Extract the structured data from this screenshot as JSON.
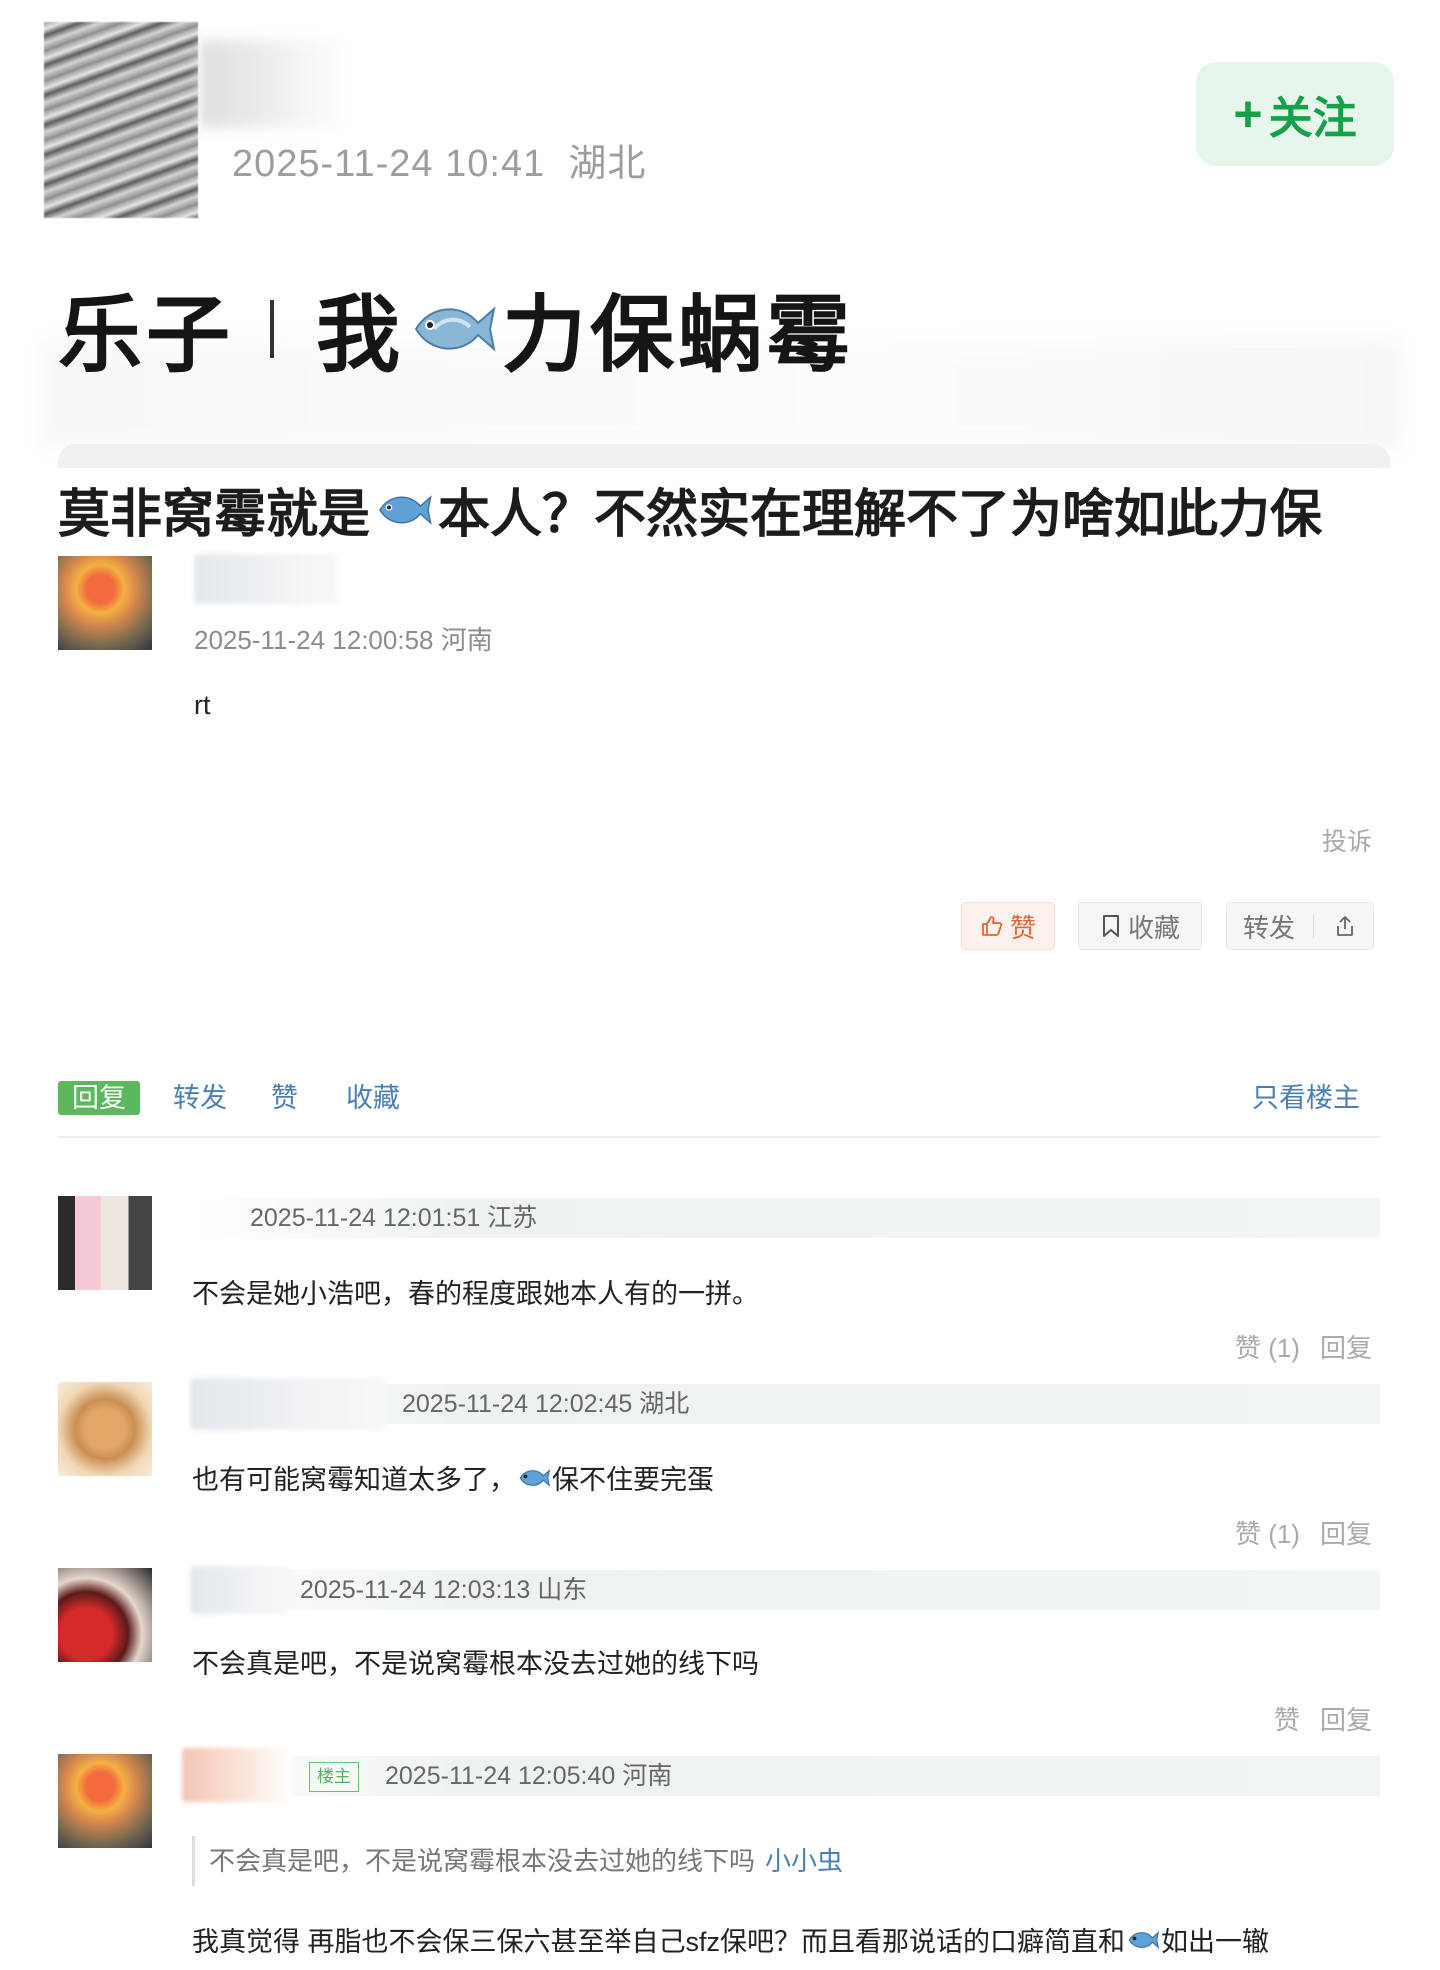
{
  "header": {
    "timestamp": "2025-11-24 10:41",
    "location": "湖北",
    "follow_label": "关注",
    "follow_plus": "+",
    "headline_part1": "乐子",
    "headline_part2": "我",
    "headline_part3": "力保蜗霉"
  },
  "post": {
    "title_part1": "莫非窝霉就是",
    "title_part2": "本人？不然实在理解不了为啥如此力保",
    "meta": "2025-11-24 12:00:58 河南",
    "body": "rt",
    "report_label": "投诉",
    "like_label": "赞",
    "favorite_label": "收藏",
    "forward_label": "转发"
  },
  "tabs": {
    "reply": "回复",
    "forward": "转发",
    "like": "赞",
    "favorite": "收藏",
    "only_op": "只看楼主"
  },
  "comments": [
    {
      "meta": "2025-11-24 12:01:51 江苏",
      "text": "不会是她小浩吧，春的程度跟她本人有的一拼。",
      "like_label": "赞 (1)",
      "reply_label": "回复"
    },
    {
      "meta": "2025-11-24 12:02:45 湖北",
      "text_part1": "也有可能窝霉知道太多了，",
      "text_part2": "保不住要完蛋",
      "like_label": "赞 (1)",
      "reply_label": "回复"
    },
    {
      "meta": "2025-11-24 12:03:13 山东",
      "text": "不会真是吧，不是说窝霉根本没去过她的线下吗",
      "like_label": "赞",
      "reply_label": "回复"
    },
    {
      "op_badge": "楼主",
      "meta": "2025-11-24 12:05:40 河南",
      "quote_text": "不会真是吧，不是说窝霉根本没去过她的线下吗",
      "quote_name": "小小虫",
      "text_part1": "我真觉得 再脂也不会保三保六甚至举自己sfz保吧？而且看那说话的口癖简直和",
      "text_part2": "如出一辙"
    }
  ],
  "icons": {
    "fish": "fish-emoji-icon",
    "like": "thumbs-up-icon",
    "favorite": "bookmark-icon",
    "share": "share-icon"
  },
  "colors": {
    "follow_green": "#15a14a",
    "reply_tab_green": "#5cb85c",
    "link_blue": "#4a7fb4",
    "like_orange": "#e0663a"
  }
}
